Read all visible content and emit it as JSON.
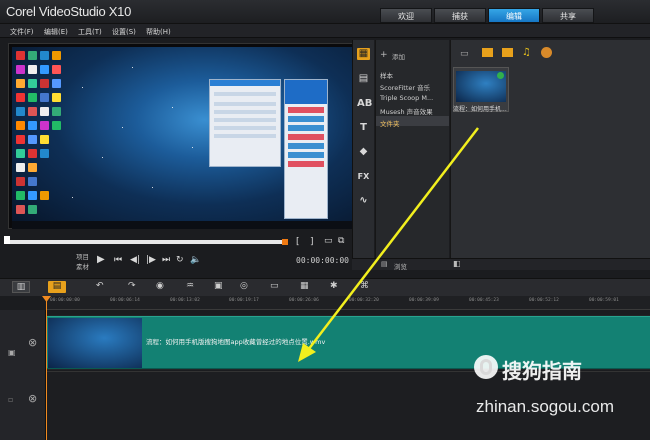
{
  "app": {
    "title": "Corel VideoStudio X10"
  },
  "top_tabs": [
    {
      "label": "欢迎"
    },
    {
      "label": "捕获"
    },
    {
      "label": "编辑",
      "active": true
    },
    {
      "label": "共享"
    }
  ],
  "menu": [
    {
      "label": "文件(F)"
    },
    {
      "label": "编辑(E)"
    },
    {
      "label": "工具(T)"
    },
    {
      "label": "设置(S)"
    },
    {
      "label": "帮助(H)"
    }
  ],
  "preview": {
    "mode_project": "项目",
    "mode_clip": "素材",
    "timecode": "00:00:00:00",
    "scrub_progress": 0.0
  },
  "library": {
    "add_label": "添加",
    "items": [
      {
        "label": "样本"
      },
      {
        "label": "ScoreFitter 音乐"
      },
      {
        "label": "Triple Scoop M..."
      },
      {
        "label": "Musesh 声音效果"
      },
      {
        "label": "文件夹"
      }
    ],
    "browse_label": "浏览",
    "thumb_caption": "流程：如何用手机..."
  },
  "timeline": {
    "ruler_ticks": [
      "00:00:00:00",
      "00:00:06:14",
      "00:00:13:02",
      "00:00:19:17",
      "00:00:26:06",
      "00:00:32:20",
      "00:00:39:09",
      "00:00:45:23",
      "00:00:52:12",
      "00:00:59:01"
    ],
    "clip_label": "流程：如何用手机版搜狗地图app收藏曾经过的地点位置.wmv"
  },
  "watermark": {
    "brand": "搜狗指南",
    "url": "zhinan.sogou.com"
  },
  "colors": {
    "accent_blue": "#1f8ad6",
    "clip_teal": "#138173",
    "playhead_orange": "#f08a20",
    "annotation_yellow": "#f2ef1e"
  }
}
